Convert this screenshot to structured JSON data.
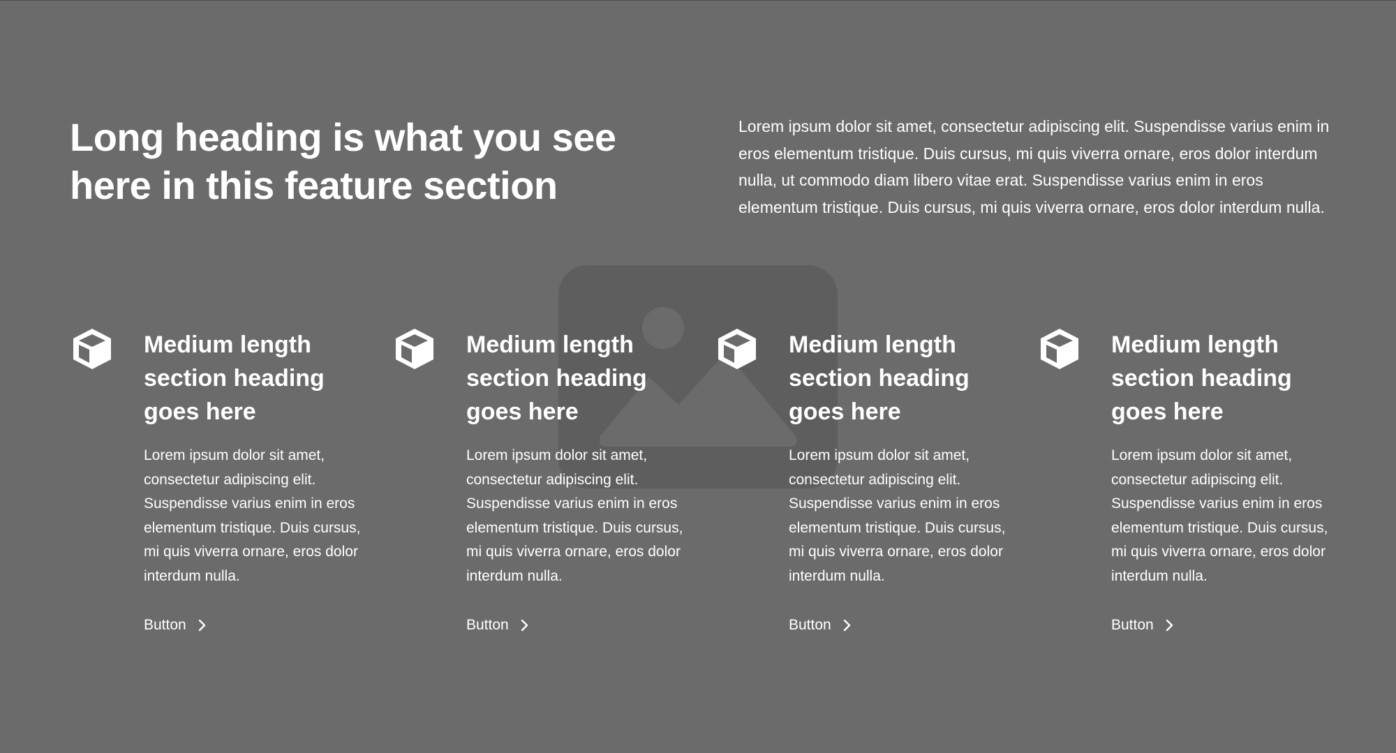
{
  "header": {
    "title": "Long heading is what you see here in this feature section",
    "description": "Lorem ipsum dolor sit amet, consectetur adipiscing elit. Suspendisse varius enim in eros elementum tristique. Duis cursus, mi quis viverra ornare, eros dolor interdum nulla, ut commodo diam libero vitae erat. Suspendisse varius enim in eros elementum tristique. Duis cursus, mi quis viverra ornare, eros dolor interdum nulla."
  },
  "features": [
    {
      "icon": "cube-icon",
      "title": "Medium length section heading goes here",
      "text": "Lorem ipsum dolor sit amet, consectetur adipiscing elit. Suspendisse varius enim in eros elementum tristique. Duis cursus, mi quis viverra ornare, eros dolor interdum nulla.",
      "button_label": "Button"
    },
    {
      "icon": "cube-icon",
      "title": "Medium length section heading goes here",
      "text": "Lorem ipsum dolor sit amet, consectetur adipiscing elit. Suspendisse varius enim in eros elementum tristique. Duis cursus, mi quis viverra ornare, eros dolor interdum nulla.",
      "button_label": "Button"
    },
    {
      "icon": "cube-icon",
      "title": "Medium length section heading goes here",
      "text": "Lorem ipsum dolor sit amet, consectetur adipiscing elit. Suspendisse varius enim in eros elementum tristique. Duis cursus, mi quis viverra ornare, eros dolor interdum nulla.",
      "button_label": "Button"
    },
    {
      "icon": "cube-icon",
      "title": "Medium length section heading goes here",
      "text": "Lorem ipsum dolor sit amet, consectetur adipiscing elit. Suspendisse varius enim in eros elementum tristique. Duis cursus, mi quis viverra ornare, eros dolor interdum nulla.",
      "button_label": "Button"
    }
  ],
  "colors": {
    "background": "#6b6b6b",
    "text": "#ffffff",
    "placeholder": "#5c5c5c"
  }
}
